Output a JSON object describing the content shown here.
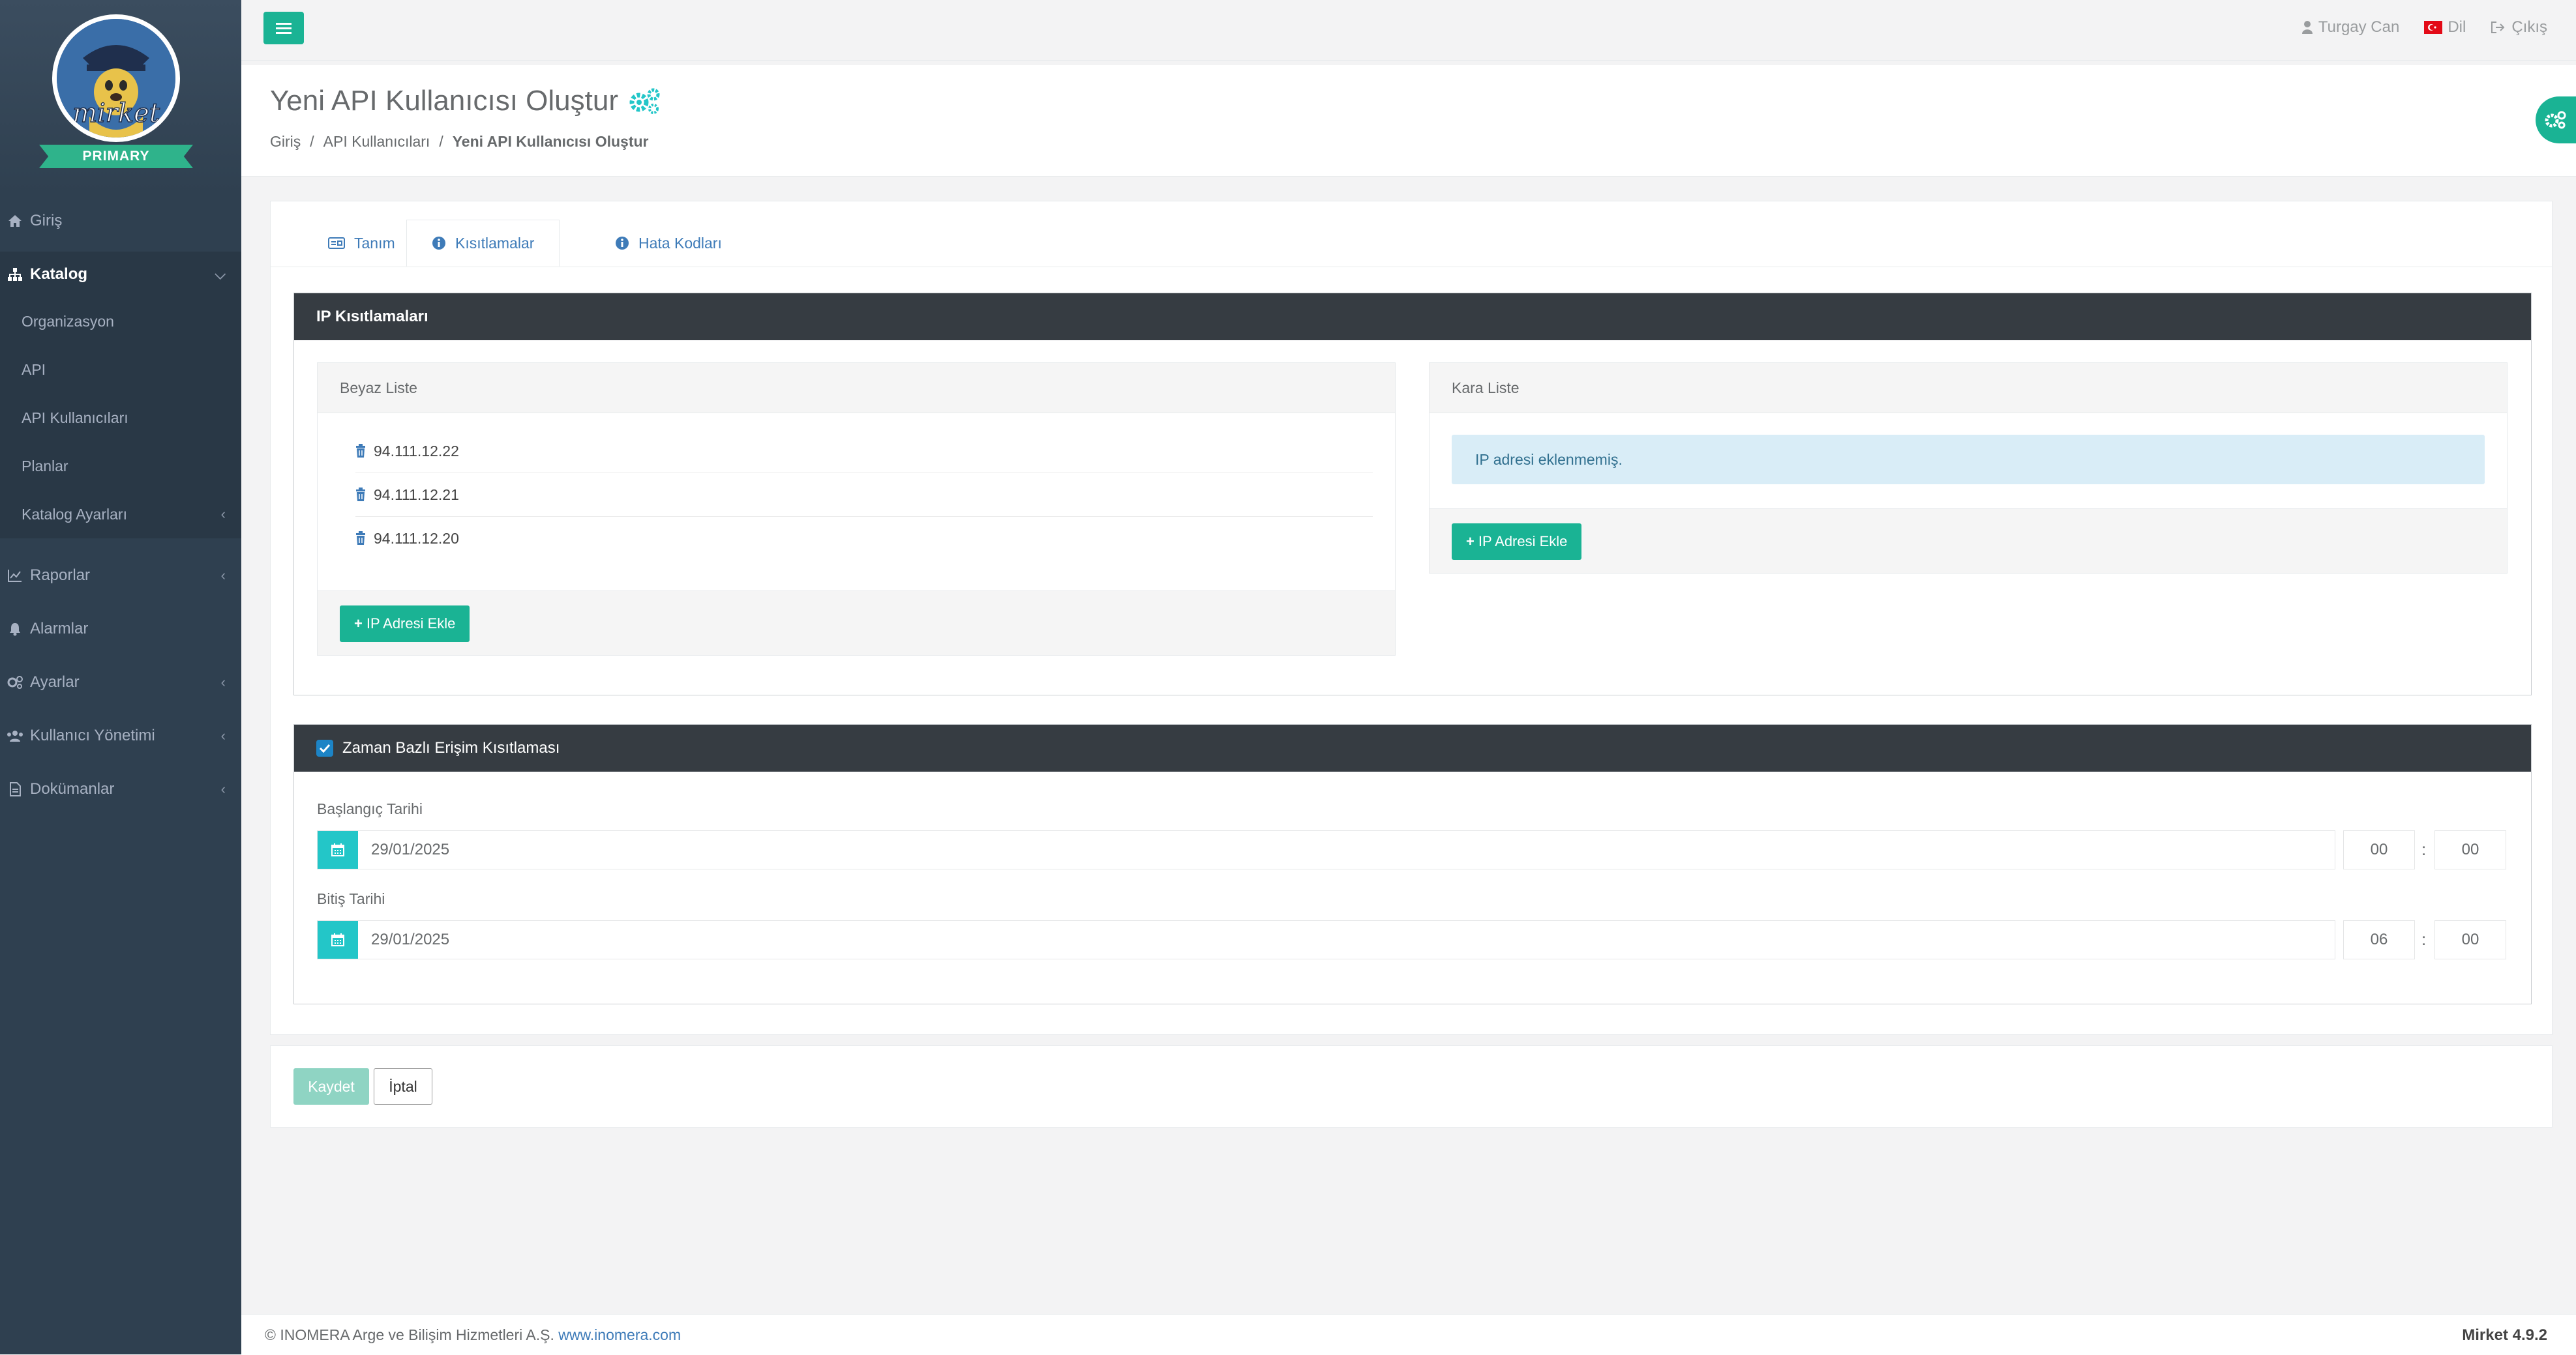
{
  "brand": {
    "logo_text": "mirket",
    "ribbon": "PRIMARY",
    "accent": "#1ab394",
    "sidebar_bg": "#2f4050"
  },
  "sidebar": {
    "items": [
      {
        "label": "Giriş",
        "icon": "home-icon"
      },
      {
        "label": "Katalog",
        "icon": "sitemap-icon"
      },
      {
        "label": "Organizasyon"
      },
      {
        "label": "API"
      },
      {
        "label": "API Kullanıcıları"
      },
      {
        "label": "Planlar"
      },
      {
        "label": "Katalog Ayarları"
      },
      {
        "label": "Raporlar",
        "icon": "chart-icon"
      },
      {
        "label": "Alarmlar",
        "icon": "bell-icon"
      },
      {
        "label": "Ayarlar",
        "icon": "gears-icon"
      },
      {
        "label": "Kullanıcı Yönetimi",
        "icon": "users-icon"
      },
      {
        "label": "Dokümanlar",
        "icon": "file-icon"
      }
    ]
  },
  "topbar": {
    "user": "Turgay Can",
    "language": "Dil",
    "logout": "Çıkış"
  },
  "heading": {
    "title": "Yeni API Kullanıcısı Oluştur",
    "breadcrumb": [
      "Giriş",
      "API Kullanıcıları",
      "Yeni API Kullanıcısı Oluştur"
    ]
  },
  "tabs": [
    {
      "label": "Tanım"
    },
    {
      "label": "Kısıtlamalar"
    },
    {
      "label": "Hata Kodları"
    }
  ],
  "ip_restrictions": {
    "title": "IP Kısıtlamaları",
    "whitelist": {
      "title": "Beyaz Liste",
      "ips": [
        "94.111.12.22",
        "94.111.12.21",
        "94.111.12.20"
      ],
      "add_button": "IP Adresi Ekle"
    },
    "blacklist": {
      "title": "Kara Liste",
      "empty_message": "IP adresi eklenmemiş.",
      "add_button": "IP Adresi Ekle"
    }
  },
  "time_restriction": {
    "title": "Zaman Bazlı Erişim Kısıtlaması",
    "checked": true,
    "start": {
      "label": "Başlangıç Tarihi",
      "date": "29/01/2025",
      "hour": "00",
      "minute": "00"
    },
    "end": {
      "label": "Bitiş Tarihi",
      "date": "29/01/2025",
      "hour": "06",
      "minute": "00"
    }
  },
  "actions": {
    "save": "Kaydet",
    "cancel": "İptal"
  },
  "footer": {
    "copyright": "© INOMERA Arge ve Bilişim Hizmetleri A.Ş.",
    "link": "www.inomera.com",
    "version": "Mirket 4.9.2"
  }
}
